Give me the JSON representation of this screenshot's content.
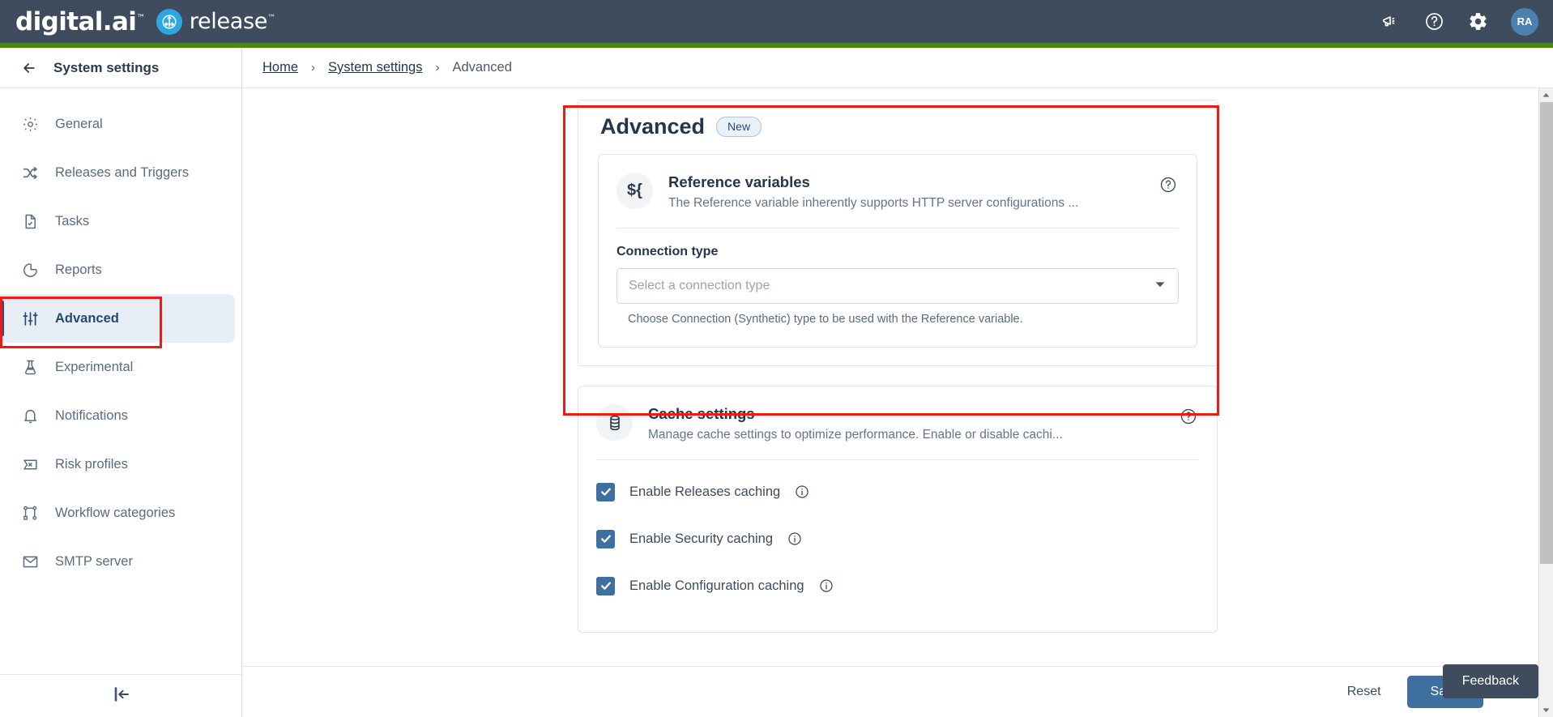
{
  "header": {
    "brand_primary": "digital.ai",
    "brand_tm": "™",
    "brand_secondary": "release",
    "icons": {
      "announcement": "announcement-icon",
      "help": "help-icon",
      "settings": "gear-icon"
    },
    "avatar_initials": "RA"
  },
  "sidebar": {
    "title": "System settings",
    "back_icon": "arrow-left-icon",
    "collapse_icon": "collapse-sidebar-icon",
    "items": [
      {
        "label": "General",
        "icon": "gear-icon",
        "active": false
      },
      {
        "label": "Releases and Triggers",
        "icon": "shuffle-icon",
        "active": false
      },
      {
        "label": "Tasks",
        "icon": "task-document-icon",
        "active": false
      },
      {
        "label": "Reports",
        "icon": "pie-chart-icon",
        "active": false
      },
      {
        "label": "Advanced",
        "icon": "sliders-icon",
        "active": true
      },
      {
        "label": "Experimental",
        "icon": "flask-icon",
        "active": false
      },
      {
        "label": "Notifications",
        "icon": "bell-icon",
        "active": false
      },
      {
        "label": "Risk profiles",
        "icon": "risk-flag-icon",
        "active": false
      },
      {
        "label": "Workflow categories",
        "icon": "workflow-nodes-icon",
        "active": false
      },
      {
        "label": "SMTP server",
        "icon": "envelope-icon",
        "active": false
      }
    ]
  },
  "breadcrumb": {
    "home": "Home",
    "system_settings": "System settings",
    "current": "Advanced",
    "separator": "›"
  },
  "main": {
    "page_title": "Advanced",
    "badge": "New",
    "reference_variables": {
      "icon_text": "${",
      "title": "Reference variables",
      "description": "The Reference variable inherently supports HTTP server configurations ...",
      "help_icon": "help-circle-icon",
      "field_label": "Connection type",
      "select_placeholder": "Select a connection type",
      "select_caret": "chevron-down-icon",
      "hint": "Choose Connection (Synthetic) type to be used with the Reference variable."
    },
    "cache_settings": {
      "icon": "database-icon",
      "title": "Cache settings",
      "description": "Manage cache settings to optimize performance. Enable or disable cachi...",
      "help_icon": "help-circle-icon",
      "checkboxes": [
        {
          "label": "Enable Releases caching",
          "checked": true,
          "info_icon": "info-icon"
        },
        {
          "label": "Enable Security caching",
          "checked": true,
          "info_icon": "info-icon"
        },
        {
          "label": "Enable Configuration caching",
          "checked": true,
          "info_icon": "info-icon"
        }
      ]
    }
  },
  "footer": {
    "reset_label": "Reset",
    "save_label": "Save",
    "feedback_label": "Feedback"
  },
  "colors": {
    "header_bg": "#3e4c5e",
    "accent_green": "#4a8b06",
    "primary_blue": "#3f6f9f",
    "active_nav_bg": "#e8eef6",
    "annotation_red": "#ee1b13"
  }
}
